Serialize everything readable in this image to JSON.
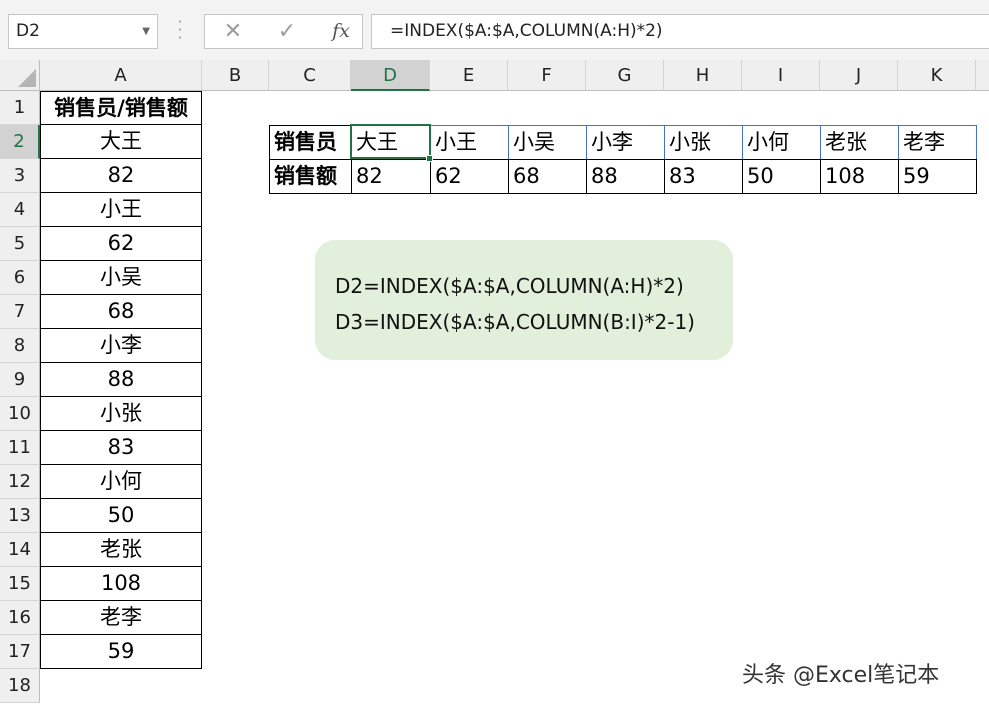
{
  "formula_bar": {
    "name_box": "D2",
    "cancel_icon": "✕",
    "enter_icon": "✓",
    "fx_label": "fx",
    "formula": "=INDEX($A:$A,COLUMN(A:H)*2)"
  },
  "columns": [
    "A",
    "B",
    "C",
    "D",
    "E",
    "F",
    "G",
    "H",
    "I",
    "J",
    "K"
  ],
  "selected_column": "D",
  "rows": [
    "1",
    "2",
    "3",
    "4",
    "5",
    "6",
    "7",
    "8",
    "9",
    "10",
    "11",
    "12",
    "13",
    "14",
    "15",
    "16",
    "17",
    "18"
  ],
  "selected_row": "2",
  "column_a": [
    "销售员/销售额",
    "大王",
    "82",
    "小王",
    "62",
    "小吴",
    "68",
    "小李",
    "88",
    "小张",
    "83",
    "小何",
    "50",
    "老张",
    "108",
    "老李",
    "59"
  ],
  "result_table": {
    "row1_label": "销售员",
    "row2_label": "销售额",
    "names": [
      "大王",
      "小王",
      "小吴",
      "小李",
      "小张",
      "小何",
      "老张",
      "老李"
    ],
    "sales": [
      "82",
      "62",
      "68",
      "88",
      "83",
      "50",
      "108",
      "59"
    ]
  },
  "note": {
    "line1": "D2=INDEX($A:$A,COLUMN(A:H)*2)",
    "line2": "D3=INDEX($A:$A,COLUMN(B:I)*2-1)"
  },
  "watermark": "头条 @Excel笔记本"
}
